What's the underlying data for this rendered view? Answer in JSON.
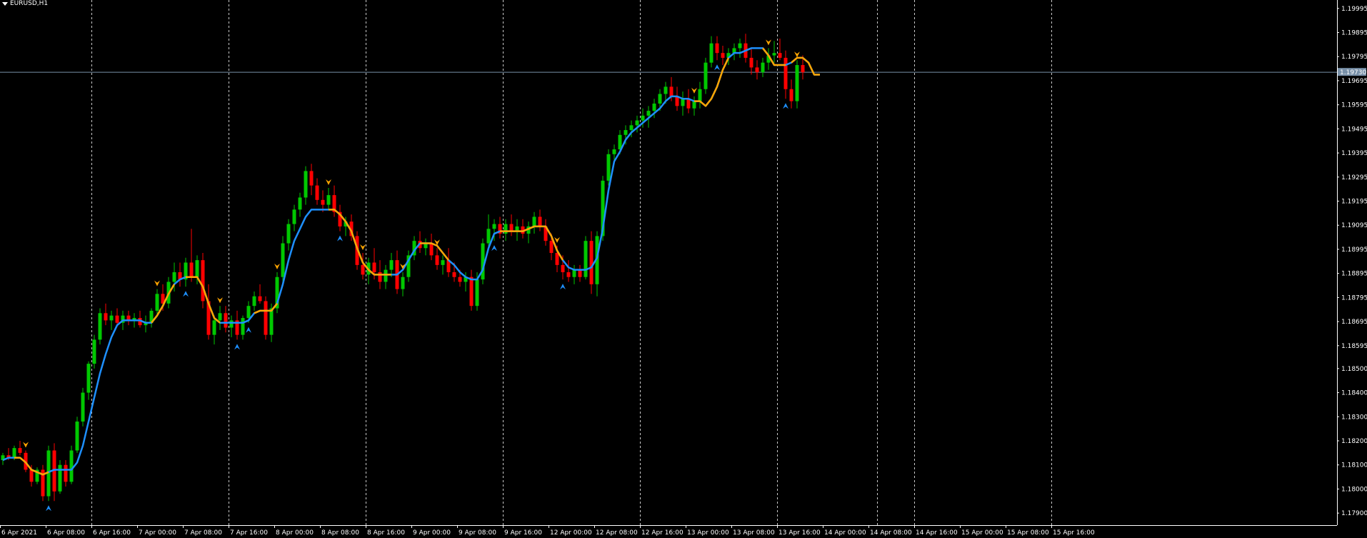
{
  "window": {
    "symbol_label": "EURUSD,H1"
  },
  "colors": {
    "background": "#000000",
    "axis": "#ffffff",
    "grid": "#c8c8c8",
    "bull": "#00c800",
    "bear": "#ff0000",
    "ma_up": "#1e90ff",
    "ma_down": "#ffa500",
    "price_line": "#7890a8"
  },
  "chart_data": {
    "type": "candlestick",
    "title": "EURUSD,H1",
    "price_axis_ticks": [
      "1.19995",
      "1.19895",
      "1.19795",
      "1.19695",
      "1.19595",
      "1.19495",
      "1.19395",
      "1.19295",
      "1.19195",
      "1.19095",
      "1.18995",
      "1.18895",
      "1.18795",
      "1.18695",
      "1.18595",
      "1.18500",
      "1.18400",
      "1.18300",
      "1.18200",
      "1.18100",
      "1.18000",
      "1.17900"
    ],
    "current_price": "1.19730",
    "time_axis_labels": [
      "6 Apr 2021",
      "6 Apr 08:00",
      "6 Apr 16:00",
      "7 Apr 00:00",
      "7 Apr 08:00",
      "7 Apr 16:00",
      "8 Apr 00:00",
      "8 Apr 08:00",
      "8 Apr 16:00",
      "9 Apr 00:00",
      "9 Apr 08:00",
      "9 Apr 16:00",
      "12 Apr 00:00",
      "12 Apr 08:00",
      "12 Apr 16:00",
      "13 Apr 00:00",
      "13 Apr 08:00",
      "13 Apr 16:00",
      "14 Apr 00:00",
      "14 Apr 08:00",
      "14 Apr 16:00",
      "15 Apr 00:00",
      "15 Apr 08:00",
      "15 Apr 16:00"
    ],
    "ylim": [
      1.1785,
      1.2003
    ],
    "bars_per_label": 8,
    "grid": "vertical dashed at each day start",
    "candles": [
      [
        1.1812,
        1.1815,
        1.181,
        1.1814
      ],
      [
        1.1814,
        1.1817,
        1.1812,
        1.1813
      ],
      [
        1.1813,
        1.1818,
        1.1812,
        1.1817
      ],
      [
        1.1817,
        1.182,
        1.1814,
        1.1815
      ],
      [
        1.1815,
        1.1816,
        1.1807,
        1.1808
      ],
      [
        1.1808,
        1.181,
        1.1801,
        1.1803
      ],
      [
        1.1803,
        1.1809,
        1.1802,
        1.1808
      ],
      [
        1.1808,
        1.181,
        1.1795,
        1.1797
      ],
      [
        1.1797,
        1.1818,
        1.1795,
        1.1816
      ],
      [
        1.1816,
        1.1819,
        1.1795,
        1.1799
      ],
      [
        1.1799,
        1.1812,
        1.1798,
        1.181
      ],
      [
        1.181,
        1.1812,
        1.1801,
        1.1803
      ],
      [
        1.1803,
        1.1818,
        1.1802,
        1.1816
      ],
      [
        1.1816,
        1.183,
        1.1815,
        1.1828
      ],
      [
        1.1828,
        1.1842,
        1.1826,
        1.184
      ],
      [
        1.184,
        1.1853,
        1.1837,
        1.1852
      ],
      [
        1.1852,
        1.1864,
        1.185,
        1.1862
      ],
      [
        1.1862,
        1.1875,
        1.186,
        1.1873
      ],
      [
        1.1873,
        1.1877,
        1.1868,
        1.187
      ],
      [
        1.187,
        1.1874,
        1.1866,
        1.1872
      ],
      [
        1.1872,
        1.1875,
        1.1868,
        1.1869
      ],
      [
        1.1869,
        1.1874,
        1.1866,
        1.1872
      ],
      [
        1.1872,
        1.1874,
        1.1868,
        1.187
      ],
      [
        1.187,
        1.1873,
        1.1867,
        1.1871
      ],
      [
        1.1871,
        1.1874,
        1.1867,
        1.1868
      ],
      [
        1.1868,
        1.1872,
        1.1865,
        1.1869
      ],
      [
        1.1869,
        1.1875,
        1.1867,
        1.1874
      ],
      [
        1.1874,
        1.1883,
        1.1872,
        1.1881
      ],
      [
        1.1881,
        1.1885,
        1.1874,
        1.1877
      ],
      [
        1.1877,
        1.1888,
        1.1875,
        1.1886
      ],
      [
        1.1886,
        1.1894,
        1.1882,
        1.189
      ],
      [
        1.189,
        1.1894,
        1.1884,
        1.1887
      ],
      [
        1.1887,
        1.1896,
        1.1884,
        1.1894
      ],
      [
        1.1894,
        1.1908,
        1.1886,
        1.1888
      ],
      [
        1.1888,
        1.1897,
        1.1885,
        1.1895
      ],
      [
        1.1895,
        1.1898,
        1.1875,
        1.1878
      ],
      [
        1.1878,
        1.1885,
        1.1862,
        1.1864
      ],
      [
        1.1864,
        1.1872,
        1.186,
        1.187
      ],
      [
        1.187,
        1.1876,
        1.1866,
        1.1873
      ],
      [
        1.1873,
        1.1876,
        1.1865,
        1.1867
      ],
      [
        1.1867,
        1.1872,
        1.1863,
        1.187
      ],
      [
        1.187,
        1.1874,
        1.1862,
        1.1864
      ],
      [
        1.1864,
        1.1872,
        1.1862,
        1.1871
      ],
      [
        1.1871,
        1.1878,
        1.1869,
        1.1876
      ],
      [
        1.1876,
        1.1882,
        1.1874,
        1.188
      ],
      [
        1.188,
        1.1885,
        1.1877,
        1.1878
      ],
      [
        1.1878,
        1.188,
        1.1862,
        1.1864
      ],
      [
        1.1864,
        1.1877,
        1.1861,
        1.1875
      ],
      [
        1.1875,
        1.189,
        1.1873,
        1.1888
      ],
      [
        1.1888,
        1.1905,
        1.1886,
        1.1902
      ],
      [
        1.1902,
        1.1912,
        1.1899,
        1.191
      ],
      [
        1.191,
        1.1918,
        1.1907,
        1.1916
      ],
      [
        1.1916,
        1.1923,
        1.1913,
        1.1921
      ],
      [
        1.1921,
        1.1934,
        1.1918,
        1.1932
      ],
      [
        1.1932,
        1.1935,
        1.1922,
        1.1926
      ],
      [
        1.1926,
        1.1929,
        1.1918,
        1.192
      ],
      [
        1.192,
        1.1924,
        1.1915,
        1.1918
      ],
      [
        1.1918,
        1.1925,
        1.1916,
        1.1922
      ],
      [
        1.1922,
        1.1926,
        1.1913,
        1.1915
      ],
      [
        1.1915,
        1.1918,
        1.1907,
        1.1909
      ],
      [
        1.1909,
        1.1913,
        1.1905,
        1.1911
      ],
      [
        1.1911,
        1.1914,
        1.1903,
        1.1905
      ],
      [
        1.1905,
        1.1907,
        1.1891,
        1.1893
      ],
      [
        1.1893,
        1.1898,
        1.1887,
        1.1889
      ],
      [
        1.1889,
        1.1896,
        1.1885,
        1.1894
      ],
      [
        1.1894,
        1.19,
        1.1887,
        1.189
      ],
      [
        1.189,
        1.1895,
        1.1883,
        1.1886
      ],
      [
        1.1886,
        1.1893,
        1.1883,
        1.1891
      ],
      [
        1.1891,
        1.1898,
        1.1888,
        1.1895
      ],
      [
        1.1895,
        1.1899,
        1.1881,
        1.1883
      ],
      [
        1.1883,
        1.189,
        1.188,
        1.1888
      ],
      [
        1.1888,
        1.1899,
        1.1886,
        1.1897
      ],
      [
        1.1897,
        1.1905,
        1.1895,
        1.1903
      ],
      [
        1.1903,
        1.1907,
        1.1898,
        1.19
      ],
      [
        1.19,
        1.1904,
        1.1897,
        1.1902
      ],
      [
        1.1902,
        1.1906,
        1.1895,
        1.1897
      ],
      [
        1.1897,
        1.19,
        1.1891,
        1.1893
      ],
      [
        1.1893,
        1.1897,
        1.1889,
        1.1895
      ],
      [
        1.1895,
        1.19,
        1.1888,
        1.189
      ],
      [
        1.189,
        1.1894,
        1.1886,
        1.1888
      ],
      [
        1.1888,
        1.1891,
        1.1884,
        1.1886
      ],
      [
        1.1886,
        1.189,
        1.1882,
        1.1888
      ],
      [
        1.1888,
        1.1891,
        1.1874,
        1.1876
      ],
      [
        1.1876,
        1.189,
        1.1874,
        1.1887
      ],
      [
        1.1887,
        1.1904,
        1.1885,
        1.1902
      ],
      [
        1.1902,
        1.1914,
        1.19,
        1.1908
      ],
      [
        1.1908,
        1.1912,
        1.1903,
        1.191
      ],
      [
        1.191,
        1.1913,
        1.1904,
        1.1906
      ],
      [
        1.1906,
        1.1912,
        1.1903,
        1.191
      ],
      [
        1.191,
        1.1914,
        1.1905,
        1.1907
      ],
      [
        1.1907,
        1.1912,
        1.1903,
        1.1909
      ],
      [
        1.1909,
        1.1912,
        1.1904,
        1.1906
      ],
      [
        1.1906,
        1.1911,
        1.1902,
        1.1909
      ],
      [
        1.1909,
        1.1915,
        1.1906,
        1.1913
      ],
      [
        1.1913,
        1.1916,
        1.1907,
        1.1909
      ],
      [
        1.1909,
        1.1912,
        1.1901,
        1.1903
      ],
      [
        1.1903,
        1.1906,
        1.1895,
        1.1898
      ],
      [
        1.1898,
        1.1901,
        1.189,
        1.1893
      ],
      [
        1.1893,
        1.1897,
        1.1887,
        1.189
      ],
      [
        1.189,
        1.1895,
        1.1886,
        1.1888
      ],
      [
        1.1888,
        1.1893,
        1.1885,
        1.1891
      ],
      [
        1.1891,
        1.1893,
        1.1886,
        1.1888
      ],
      [
        1.1888,
        1.1905,
        1.1887,
        1.1903
      ],
      [
        1.1903,
        1.1907,
        1.1881,
        1.1885
      ],
      [
        1.1885,
        1.1907,
        1.188,
        1.1905
      ],
      [
        1.1905,
        1.193,
        1.1903,
        1.1928
      ],
      [
        1.1928,
        1.1941,
        1.1926,
        1.1939
      ],
      [
        1.1939,
        1.1943,
        1.1935,
        1.1941
      ],
      [
        1.1941,
        1.1949,
        1.1939,
        1.1947
      ],
      [
        1.1947,
        1.1951,
        1.1943,
        1.1949
      ],
      [
        1.1949,
        1.1953,
        1.1946,
        1.1951
      ],
      [
        1.1951,
        1.1955,
        1.1948,
        1.1953
      ],
      [
        1.1953,
        1.1958,
        1.195,
        1.1955
      ],
      [
        1.1955,
        1.1959,
        1.195,
        1.1957
      ],
      [
        1.1957,
        1.1962,
        1.1954,
        1.196
      ],
      [
        1.196,
        1.1966,
        1.1957,
        1.1964
      ],
      [
        1.1964,
        1.1969,
        1.196,
        1.1967
      ],
      [
        1.1967,
        1.1971,
        1.1961,
        1.1963
      ],
      [
        1.1963,
        1.1967,
        1.1957,
        1.1959
      ],
      [
        1.1959,
        1.1965,
        1.1955,
        1.1962
      ],
      [
        1.1962,
        1.1966,
        1.1956,
        1.1958
      ],
      [
        1.1958,
        1.1963,
        1.1955,
        1.1961
      ],
      [
        1.1961,
        1.1969,
        1.1958,
        1.1966
      ],
      [
        1.1966,
        1.1979,
        1.1964,
        1.1977
      ],
      [
        1.1977,
        1.1988,
        1.1975,
        1.1985
      ],
      [
        1.1985,
        1.1988,
        1.1978,
        1.1981
      ],
      [
        1.1981,
        1.1984,
        1.1976,
        1.1979
      ],
      [
        1.1979,
        1.1983,
        1.1976,
        1.1981
      ],
      [
        1.1981,
        1.1985,
        1.1978,
        1.1983
      ],
      [
        1.1983,
        1.1987,
        1.1979,
        1.1985
      ],
      [
        1.1985,
        1.1989,
        1.1977,
        1.1979
      ],
      [
        1.1979,
        1.1983,
        1.1972,
        1.1975
      ],
      [
        1.1975,
        1.1978,
        1.197,
        1.1973
      ],
      [
        1.1973,
        1.1979,
        1.1971,
        1.1977
      ],
      [
        1.1977,
        1.1983,
        1.1974,
        1.198
      ],
      [
        1.198,
        1.1986,
        1.1977,
        1.1981
      ],
      [
        1.1981,
        1.1987,
        1.1978,
        1.1979
      ],
      [
        1.1979,
        1.1982,
        1.1962,
        1.1966
      ],
      [
        1.1966,
        1.197,
        1.1958,
        1.1961
      ],
      [
        1.1961,
        1.1978,
        1.1958,
        1.1976
      ],
      [
        1.1976,
        1.198,
        1.197,
        1.1973
      ]
    ],
    "ma_line": [
      1.1812,
      1.1813,
      1.1813,
      1.1813,
      1.1811,
      1.1808,
      1.1807,
      1.1806,
      1.1807,
      1.1808,
      1.1808,
      1.1808,
      1.1808,
      1.1811,
      1.1818,
      1.1828,
      1.1838,
      1.1848,
      1.1856,
      1.1863,
      1.1868,
      1.187,
      1.187,
      1.187,
      1.187,
      1.1869,
      1.1869,
      1.1872,
      1.1876,
      1.1881,
      1.1885,
      1.1887,
      1.1888,
      1.1888,
      1.1888,
      1.1884,
      1.1877,
      1.1871,
      1.1869,
      1.1869,
      1.1869,
      1.1869,
      1.1869,
      1.187,
      1.1873,
      1.1874,
      1.1874,
      1.1874,
      1.1877,
      1.1885,
      1.1895,
      1.1903,
      1.1908,
      1.1913,
      1.1916,
      1.1916,
      1.1916,
      1.1916,
      1.1916,
      1.1914,
      1.1911,
      1.1907,
      1.19,
      1.1894,
      1.1891,
      1.1889,
      1.1889,
      1.1889,
      1.1889,
      1.1889,
      1.1891,
      1.1895,
      1.1899,
      1.1902,
      1.1902,
      1.1902,
      1.1901,
      1.1898,
      1.1895,
      1.1893,
      1.189,
      1.1888,
      1.1887,
      1.1887,
      1.1891,
      1.19,
      1.1906,
      1.1907,
      1.1907,
      1.1907,
      1.1907,
      1.1907,
      1.1908,
      1.1909,
      1.1909,
      1.1909,
      1.1905,
      1.1899,
      1.1895,
      1.1892,
      1.1891,
      1.1891,
      1.1891,
      1.1892,
      1.1896,
      1.1908,
      1.1924,
      1.1936,
      1.194,
      1.1945,
      1.1948,
      1.195,
      1.1952,
      1.1954,
      1.1956,
      1.1958,
      1.1961,
      1.1963,
      1.1963,
      1.1962,
      1.1962,
      1.1961,
      1.1961,
      1.1959,
      1.1962,
      1.1967,
      1.1974,
      1.1979,
      1.1981,
      1.1981,
      1.1982,
      1.1983,
      1.1983,
      1.1983,
      1.198,
      1.1976,
      1.1976,
      1.1976,
      1.1977,
      1.1979,
      1.1979,
      1.1977,
      1.1972,
      1.1972
    ],
    "ma_down_segments": [
      [
        2,
        8
      ],
      [
        26,
        30
      ],
      [
        32,
        38
      ],
      [
        44,
        48
      ],
      [
        57,
        68
      ],
      [
        73,
        78
      ],
      [
        87,
        98
      ],
      [
        121,
        127
      ],
      [
        133,
        137
      ],
      [
        138,
        144
      ]
    ],
    "arrows_down": [
      4,
      27,
      38,
      48,
      57,
      63,
      70,
      76,
      97,
      121,
      134,
      139
    ],
    "arrows_up": [
      8,
      32,
      41,
      43,
      59,
      86,
      98,
      125,
      137
    ]
  }
}
